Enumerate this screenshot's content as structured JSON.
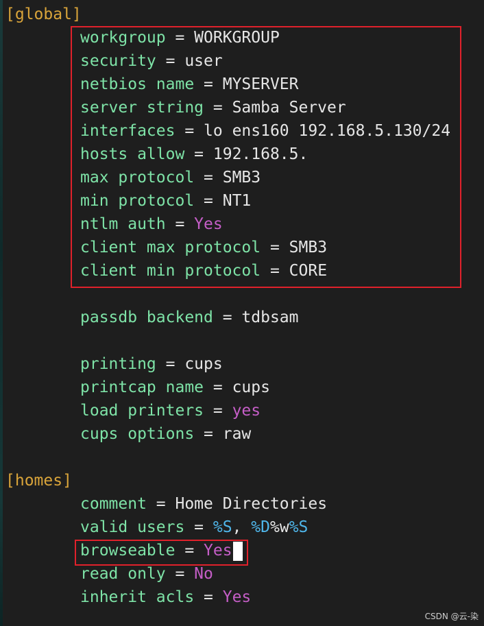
{
  "sections": {
    "global": "[global]",
    "homes": "[homes]"
  },
  "global_entries": [
    {
      "key": "workgroup",
      "value": "WORKGROUP"
    },
    {
      "key": "security",
      "value": "user"
    },
    {
      "key": "netbios name",
      "value": "MYSERVER"
    },
    {
      "key": "server string",
      "value": "Samba Server"
    },
    {
      "key": "interfaces",
      "value": "lo ens160 192.168.5.130/24"
    },
    {
      "key": "hosts allow",
      "value": "192.168.5."
    },
    {
      "key": "max protocol",
      "value": "SMB3"
    },
    {
      "key": "min protocol",
      "value": "NT1"
    },
    {
      "key": "ntlm auth",
      "value": "Yes"
    },
    {
      "key": "client max protocol",
      "value": "SMB3"
    },
    {
      "key": "client min protocol",
      "value": "CORE"
    },
    {
      "key": "passdb backend",
      "value": "tdbsam"
    },
    {
      "key": "printing",
      "value": "cups"
    },
    {
      "key": "printcap name",
      "value": "cups"
    },
    {
      "key": "load printers",
      "value": "yes"
    },
    {
      "key": "cups options",
      "value": "raw"
    }
  ],
  "homes_entries": [
    {
      "key": "comment",
      "value": "Home Directories"
    },
    {
      "key": "valid users",
      "value_parts": [
        "%S",
        ",",
        " ",
        "%D",
        "%w",
        "%S"
      ]
    },
    {
      "key": "browseable",
      "value": "Yes"
    },
    {
      "key": "read only",
      "value": "No"
    },
    {
      "key": "inherit acls",
      "value": "Yes"
    }
  ],
  "equals": " = ",
  "watermark": "CSDN @云-染",
  "colors": {
    "background": "#1e1e1e",
    "key": "#7ee3a7",
    "section": "#d9a43a",
    "keyword": "#c55ec7",
    "macro": "#4fb6ea",
    "highlight_box": "#e0212b"
  }
}
